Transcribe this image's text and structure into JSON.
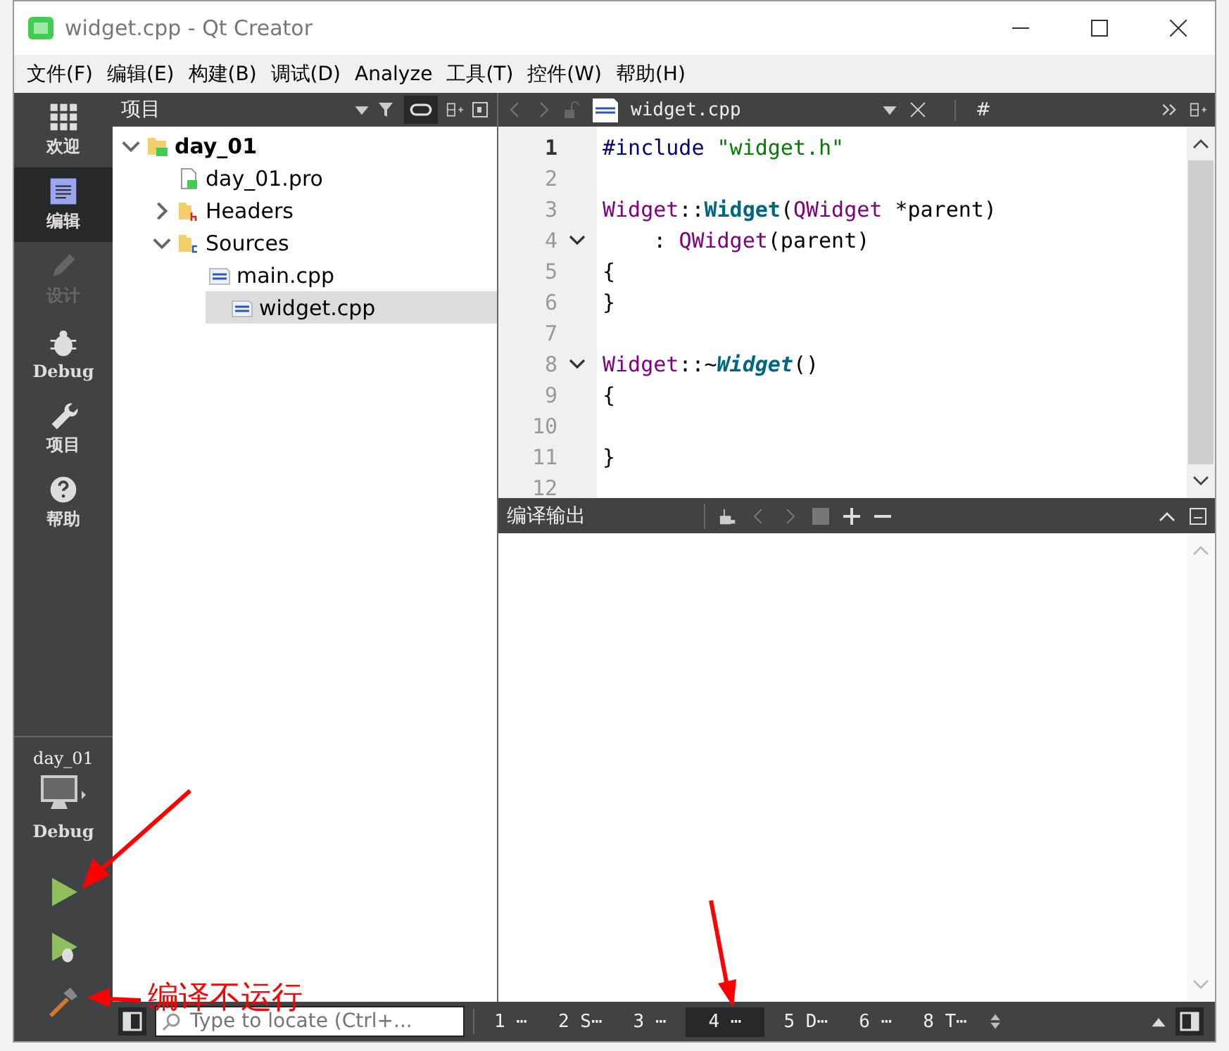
{
  "window": {
    "title": "widget.cpp - Qt Creator"
  },
  "menu": [
    "文件(F)",
    "编辑(E)",
    "构建(B)",
    "调试(D)",
    "Analyze",
    "工具(T)",
    "控件(W)",
    "帮助(H)"
  ],
  "modes": [
    {
      "label": "欢迎",
      "kind": "grid",
      "selected": false,
      "disabled": false
    },
    {
      "label": "编辑",
      "kind": "doc",
      "selected": true,
      "disabled": false
    },
    {
      "label": "设计",
      "kind": "pencil",
      "selected": false,
      "disabled": true
    },
    {
      "label": "Debug",
      "kind": "bug",
      "selected": false,
      "disabled": false
    },
    {
      "label": "项目",
      "kind": "wrench",
      "selected": false,
      "disabled": false
    },
    {
      "label": "帮助",
      "kind": "help",
      "selected": false,
      "disabled": false
    }
  ],
  "target": {
    "project": "day_01",
    "config": "Debug"
  },
  "actions": [
    {
      "kind": "run"
    },
    {
      "kind": "debug"
    },
    {
      "kind": "build"
    }
  ],
  "project_panel": {
    "title": "项目",
    "tree": [
      {
        "label": "day_01",
        "kind": "project",
        "expanded": true,
        "selected": false,
        "children": [
          {
            "label": "day_01.pro",
            "kind": "pro",
            "selected": false
          },
          {
            "label": "Headers",
            "kind": "headers",
            "expanded": false,
            "selected": false
          },
          {
            "label": "Sources",
            "kind": "sources",
            "expanded": true,
            "selected": false,
            "children": [
              {
                "label": "main.cpp",
                "kind": "cpp",
                "selected": false
              },
              {
                "label": "widget.cpp",
                "kind": "cpp",
                "selected": true
              }
            ]
          }
        ]
      }
    ]
  },
  "editor": {
    "file": "widget.cpp",
    "symbol": "#",
    "lines": [
      {
        "num": "1",
        "current": true,
        "tokens": [
          {
            "text": "#include ",
            "kind": "pre"
          },
          {
            "text": "\"widget.h\"",
            "kind": "str"
          }
        ]
      },
      {
        "num": "2",
        "current": false
      },
      {
        "num": "3",
        "current": false,
        "tokens": [
          {
            "text": "Widget",
            "kind": "type"
          },
          {
            "text": "::",
            "kind": "plain"
          },
          {
            "text": "Widget",
            "kind": "func"
          },
          {
            "text": "(",
            "kind": "plain"
          },
          {
            "text": "QWidget",
            "kind": "type"
          },
          {
            "text": " *parent)",
            "kind": "plain"
          }
        ]
      },
      {
        "num": "4",
        "current": false,
        "fold": true,
        "tokens": [
          {
            "text": "    : ",
            "kind": "plain"
          },
          {
            "text": "QWidget",
            "kind": "type"
          },
          {
            "text": "(parent)",
            "kind": "plain"
          }
        ]
      },
      {
        "num": "5",
        "current": false,
        "tokens": [
          {
            "text": "{",
            "kind": "plain"
          }
        ]
      },
      {
        "num": "6",
        "current": false,
        "tokens": [
          {
            "text": "}",
            "kind": "plain"
          }
        ]
      },
      {
        "num": "7",
        "current": false
      },
      {
        "num": "8",
        "current": false,
        "fold": true,
        "tokens": [
          {
            "text": "Widget",
            "kind": "type"
          },
          {
            "text": "::~",
            "kind": "plain"
          },
          {
            "text": "Widget",
            "kind": "funcitalic"
          },
          {
            "text": "()",
            "kind": "plain"
          }
        ]
      },
      {
        "num": "9",
        "current": false,
        "tokens": [
          {
            "text": "{",
            "kind": "plain"
          }
        ]
      },
      {
        "num": "10",
        "current": false
      },
      {
        "num": "11",
        "current": false,
        "tokens": [
          {
            "text": "}",
            "kind": "plain"
          }
        ]
      },
      {
        "num": "12",
        "current": false
      }
    ]
  },
  "output_pane": {
    "title": "编译输出"
  },
  "status_bar": {
    "locate_placeholder": "Type to locate (Ctrl+...",
    "tabs": [
      {
        "label": "1 ⋯",
        "selected": false
      },
      {
        "label": "2 S⋯",
        "selected": false
      },
      {
        "label": "3 ⋯",
        "selected": false
      },
      {
        "label": "4 ⋯",
        "selected": true
      },
      {
        "label": "5 D⋯",
        "selected": false
      },
      {
        "label": "6 ⋯",
        "selected": false
      },
      {
        "label": "8 T⋯",
        "selected": false
      }
    ]
  },
  "annotation": {
    "text": "编译不运行"
  }
}
